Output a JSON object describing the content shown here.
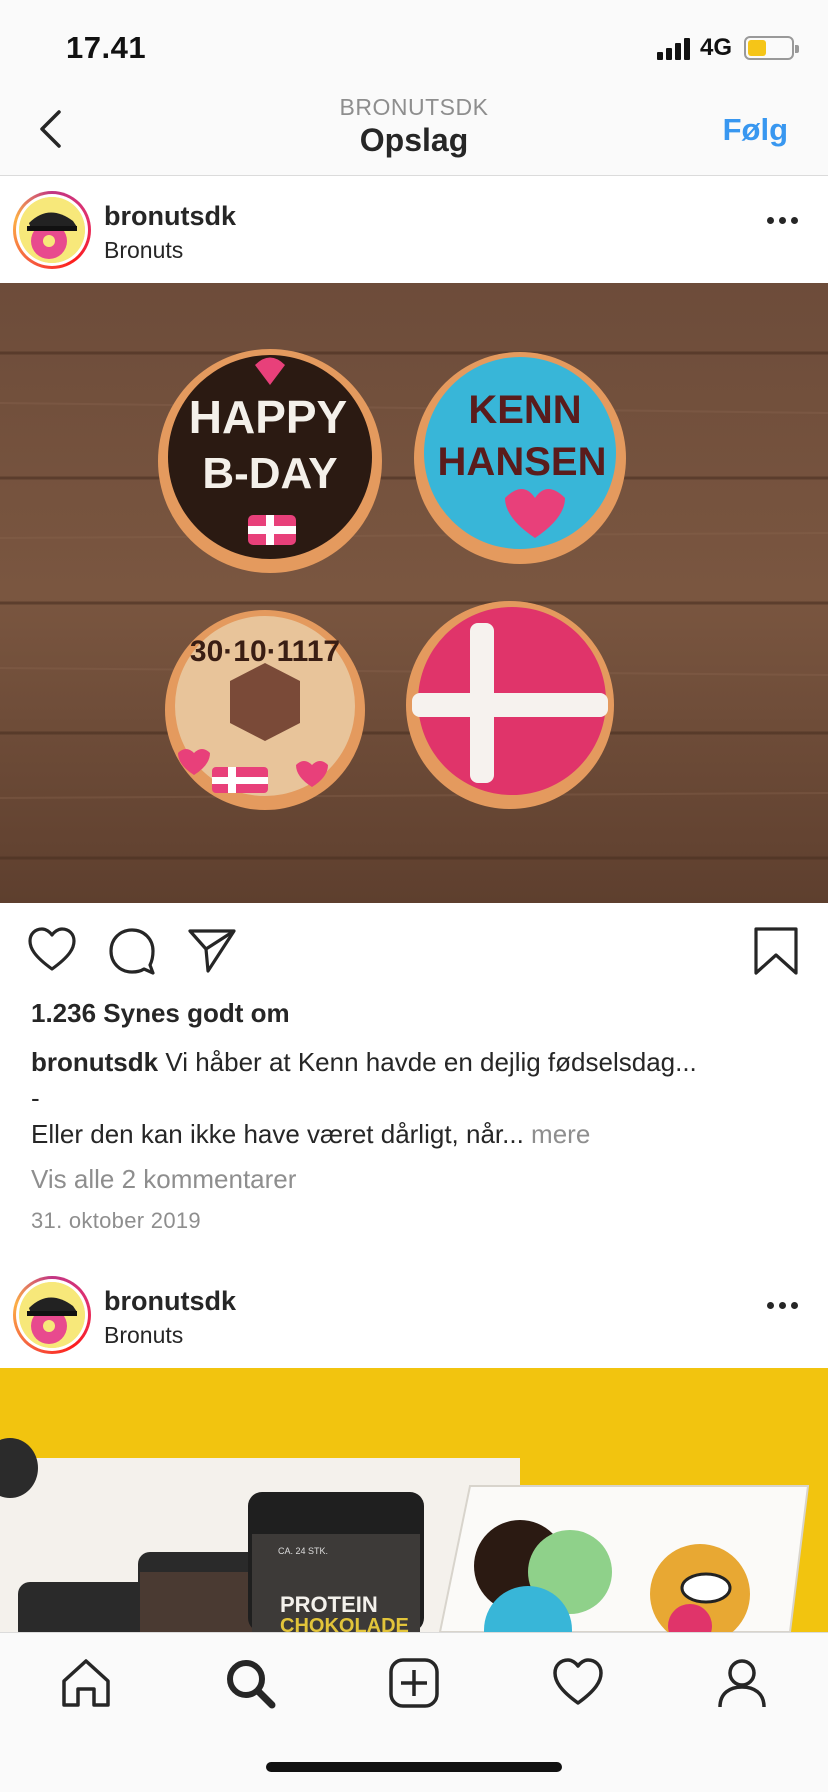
{
  "status_bar": {
    "time": "17.41",
    "network": "4G"
  },
  "header": {
    "subtitle": "BRONUTSDK",
    "title": "Opslag",
    "follow_label": "Følg"
  },
  "posts": [
    {
      "username": "bronutsdk",
      "location": "Bronuts",
      "image_text": {
        "line1": "HAPPY",
        "line2": "B-DAY",
        "name1": "KENN",
        "name2": "HANSEN",
        "date": "30·10·1117"
      },
      "likes": "1.236 Synes godt om",
      "caption_user": "bronutsdk",
      "caption_text": "Vi håber at Kenn havde en dejlig fødselsdag...",
      "caption_dash": "-",
      "caption_line2": "Eller den kan ikke have været dårligt, når...",
      "caption_more": "mere",
      "view_comments": "Vis alle 2 kommentarer",
      "date": "31. oktober 2019"
    },
    {
      "username": "bronutsdk",
      "location": "Bronuts",
      "image_text": {
        "jar_label": "PROTEIN",
        "jar_label2": "CHOKOLADE",
        "jar_small": "CA. 24 STK."
      }
    }
  ],
  "tabbar": [
    "home-icon",
    "search-icon",
    "add-post-icon",
    "activity-heart-icon",
    "profile-icon"
  ],
  "colors": {
    "accent": "#3897f0",
    "battery": "#f5c518",
    "wood": "#6b4a36",
    "yellow_wall": "#f2c40f"
  }
}
